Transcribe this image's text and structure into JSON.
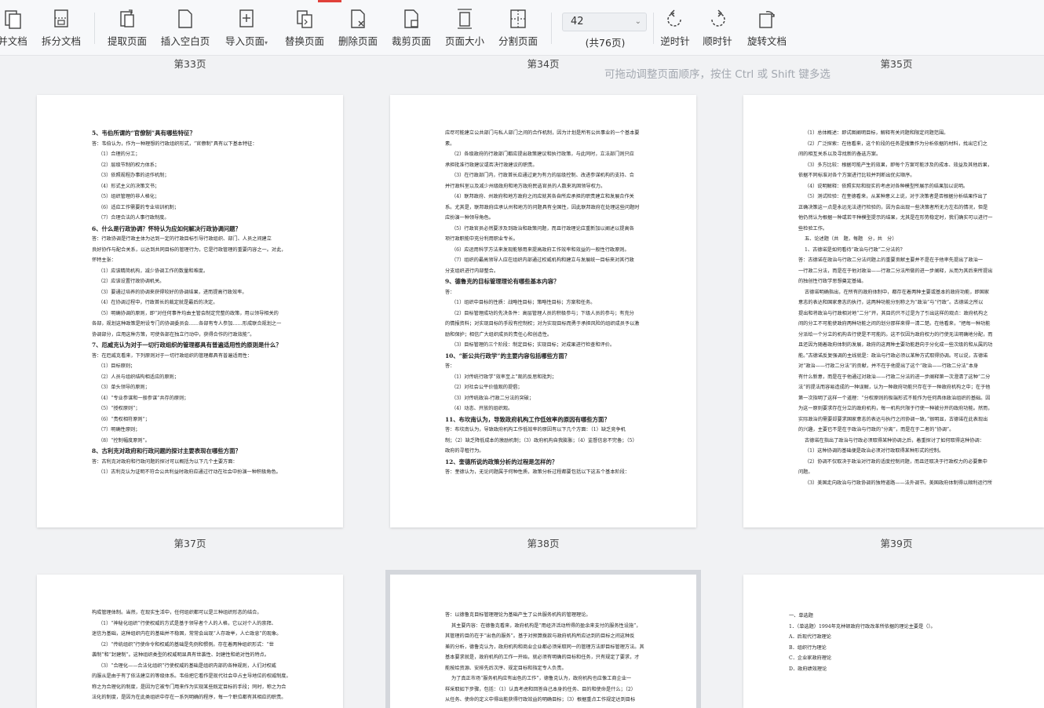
{
  "toolbar": {
    "tools": [
      {
        "label": "并文档",
        "icon": "merge-doc-icon"
      },
      {
        "label": "拆分文档",
        "icon": "split-doc-icon"
      },
      {
        "label": "提取页面",
        "icon": "extract-page-icon"
      },
      {
        "label": "插入空白页",
        "icon": "insert-blank-icon"
      },
      {
        "label": "导入页面",
        "icon": "import-page-icon"
      },
      {
        "label": "替换页面",
        "icon": "replace-page-icon"
      },
      {
        "label": "删除页面",
        "icon": "delete-page-icon"
      },
      {
        "label": "裁剪页面",
        "icon": "crop-page-icon"
      },
      {
        "label": "页面大小",
        "icon": "page-size-icon"
      },
      {
        "label": "分割页面",
        "icon": "divide-page-icon"
      },
      {
        "label": "逆时针",
        "icon": "rotate-ccw-icon"
      },
      {
        "label": "顺时针",
        "icon": "rotate-cw-icon"
      },
      {
        "label": "旋转文档",
        "icon": "rotate-doc-icon"
      }
    ],
    "page_input": "42",
    "page_count": "(共76页)",
    "dropdown_caret": "▾"
  },
  "hint": "可拖动调整页面顺序，按住 Ctrl 或 Shift 键多选",
  "top_labels": [
    "第33页",
    "第34页",
    "第35页"
  ],
  "mid_labels": [
    "第37页",
    "第38页",
    "第39页"
  ],
  "pages": [
    {
      "lines": [
        {
          "t": "5、韦伯所谓的“官僚制”具有哪些特征？",
          "c": "h"
        },
        {
          "t": "答：韦伯认为，作为一种理想的行政组织形式，“官僚制”具有以下基本特征：",
          "c": ""
        },
        {
          "t": "（1）合理的分工；",
          "c": "i"
        },
        {
          "t": "（2）层级节制的权力体系；",
          "c": "i"
        },
        {
          "t": "（3）依照规程办事的运作机制；",
          "c": "i"
        },
        {
          "t": "（4）形式主义的决策文书；",
          "c": "i"
        },
        {
          "t": "（5）组织管理的非人格化；",
          "c": "i"
        },
        {
          "t": "（6）适应工作需要的专业培训机制；",
          "c": "i"
        },
        {
          "t": "（7）合理合法的人事行政制度。",
          "c": "i"
        },
        {
          "t": "6、什么是行政协调？怀特认为应如何解决行政协调问题？",
          "c": "h"
        },
        {
          "t": "答：行政协调是行政主体为达到一定的行政目标引导行政组织、部门、人员之间建立",
          "c": ""
        },
        {
          "t": "良好协作与配合关系，以达到共同目标的管理行为，它是行政管理的重要内容之一。对此，",
          "c": ""
        },
        {
          "t": "怀特主张：",
          "c": ""
        },
        {
          "t": "（1）应该精简机构，减少协调工作的数量和难度。",
          "c": "i"
        },
        {
          "t": "（2）应该设置行政协调机关。",
          "c": "i"
        },
        {
          "t": "（3）要通过培养的协调来获得较好的协调结果，进而提高行政效率。",
          "c": "i"
        },
        {
          "t": "（4）在协调过程中，行政首长的裁定就是最后的决定。",
          "c": "i"
        },
        {
          "t": "（5）明确协调的原则，即“对任何事件均由主管会制定完整的政策，用以领导相关的",
          "c": "i"
        },
        {
          "t": "各部，规划这种政策是附设专门的协调委员会……各部有专人参加……形成联合规划之一",
          "c": ""
        },
        {
          "t": "协调部分，应用这种方策，可使各部在独立行动中，获得合作的行政效能”。",
          "c": ""
        },
        {
          "t": "7、厄威克认为对于一切行政组织的管理都具有普遍适用性的原则是什么？",
          "c": "h"
        },
        {
          "t": "答：在厄威克看来，下列原则对于一切行政组织的管理都具有普遍适用性：",
          "c": ""
        },
        {
          "t": "（1）目标原则；",
          "c": "i"
        },
        {
          "t": "（2）人员与组织结构相适应的原则；",
          "c": "i"
        },
        {
          "t": "（3）单头领导的原则；",
          "c": "i"
        },
        {
          "t": "（4）“专业参谋和一般参谋”共存的原则；",
          "c": "i"
        },
        {
          "t": "（5）“授权原则”；",
          "c": "i"
        },
        {
          "t": "（6）“责权相符原则”；",
          "c": "i"
        },
        {
          "t": "（7）明确性原则；",
          "c": "i"
        },
        {
          "t": "（8）“控制幅度原则”。",
          "c": "i"
        },
        {
          "t": "8、古利克对政府和行政问题的探讨主要表现在哪些方面？",
          "c": "h"
        },
        {
          "t": "答：古利克对政府和行政问题的探讨可以概括为以下几个主要方面：",
          "c": ""
        },
        {
          "t": "（1）古利克认为证明不符合公共利益时政府应通过行动在社会中扮演一种积极角色。",
          "c": "i"
        }
      ]
    },
    {
      "lines": [
        {
          "t": "应尽可能建立公共部门与私人部门之间的合作机制，因为计划是所有公共事业的一个基本要",
          "c": ""
        },
        {
          "t": "素。",
          "c": ""
        },
        {
          "t": "（2）各级政府的行政部门都应提出政策建议和执行政策，与此同时，立法部门则只应",
          "c": "i"
        },
        {
          "t": "承担批准行政建议或否决行政建议的职责。",
          "c": ""
        },
        {
          "t": "（3）在行政部门内，行政首长应通过更为有力的层级控制、改进参谋机构的支持、合",
          "c": "i"
        },
        {
          "t": "并行政科室以及减少州级政府和地方政府民选官员的人数来巩固领导权力。",
          "c": ""
        },
        {
          "t": "（4）联邦政府、州政府和地方政府之间应就其各自所应承担的职责建立和发展合作关",
          "c": "i"
        },
        {
          "t": "系。尤其是，联邦政府应承认州和地方的问题具有全国性，因此联邦政府在处理这些问题时",
          "c": ""
        },
        {
          "t": "应扮演一种领导角色。",
          "c": ""
        },
        {
          "t": "（5）行政官员必然要涉及到政治和政策问题，而且行政理论应重新加以阐述以提高各",
          "c": "i"
        },
        {
          "t": "项行政职能中充分利用职业专长。",
          "c": ""
        },
        {
          "t": "（6）应运用科学方法来发现能够用来提高政府工作效率和效益的一般性行政原则。",
          "c": "i"
        },
        {
          "t": "（7）组织的最高领导人应在组织内部通过权威机构和建立与发展统一目标来对其行政",
          "c": "i"
        },
        {
          "t": "分支组织进行内部整合。",
          "c": ""
        },
        {
          "t": "9、德鲁克的目标管理理论有哪些基本内容？",
          "c": "h"
        },
        {
          "t": "答：",
          "c": ""
        },
        {
          "t": "（1）组织中目标的性质：战略性目标；策略性目标；方案和任务。",
          "c": "i"
        },
        {
          "t": "（2）目标管理成功的先决条件：高层管理人员的积极参与；下级人员的参与；有充分",
          "c": "i"
        },
        {
          "t": "的情报资料；对实现目标的手段有控制权；对为实现目标而勇于承担风险的组织成员予以激",
          "c": ""
        },
        {
          "t": "励和保护；相信广大组织成员的责任心和创造性。",
          "c": ""
        },
        {
          "t": "（3）目标管理的三个阶段：制定目标；实现目标；对成果进行检查和评价。",
          "c": "i"
        },
        {
          "t": "10、“新公共行政学”的主要内容包括哪些方面？",
          "c": "h"
        },
        {
          "t": "答：",
          "c": ""
        },
        {
          "t": "（1）对传统行政学“效率至上”观的反思和批判；",
          "c": "i"
        },
        {
          "t": "（2）对社会公平价值观的提倡；",
          "c": "i"
        },
        {
          "t": "（3）对传统政治-行政二分法的突破；",
          "c": "i"
        },
        {
          "t": "（4）动态、开放的组织观。",
          "c": "i"
        },
        {
          "t": "11、布坎南认为，导致政府机构工作低效率的原因有哪些方面？",
          "c": "h"
        },
        {
          "t": "答：布坎南认为，导致政府机构工作低效率的原因有以下几个方面：（1）缺乏竞争机",
          "c": ""
        },
        {
          "t": "制；（2）缺乏降低成本的激励机制；（3）政府机构自我膨胀；（4）监督信息不完备；（5）",
          "c": ""
        },
        {
          "t": "政府的寻租行为。",
          "c": ""
        },
        {
          "t": "12、奎德所说的政策分析的过程是怎样的？",
          "c": "h"
        },
        {
          "t": "答：奎德认为，无论问题属于何种性质，政策分析过程都要包括以下这五个基本阶段：",
          "c": ""
        }
      ]
    },
    {
      "lines": [
        {
          "t": "（1）总体概述：即试图阐明目标，解释有关问题和限定问题范围。",
          "c": "i"
        },
        {
          "t": "（2）广泛探索：在他看来，这个阶段的任务是搜集作为分析依据的材料，找出它们之",
          "c": "i"
        },
        {
          "t": "间的相互关系以及寻找新的备选方案。",
          "c": ""
        },
        {
          "t": "（3）多方比较：根据可能产生的效果，即每个方案可能涉及的成本、效益及其他后果，",
          "c": "i"
        },
        {
          "t": "依据不同标准对各个方案进行比较并判断出优劣顺序。",
          "c": ""
        },
        {
          "t": "（4）说明解释：依照实际和现实的考虑对各种模型所展示的结果加以说明。",
          "c": "i"
        },
        {
          "t": "（5）测试检验：在奎德看来，从某种意义上说，对于决策者是否根据分析结果作出了",
          "c": "i"
        },
        {
          "t": "正确决策这一点是永远无法进行检验的，因为会出现一些决策者所无力左右的情况，但是",
          "c": ""
        },
        {
          "t": "他仍然认为根据一种或若干种模型提示的结果，尤其是在形势稳定时，我们确实可以进行一",
          "c": ""
        },
        {
          "t": "些检验工作。",
          "c": ""
        },
        {
          "t": "五、论述题（共　题，每题　分，共　分）",
          "c": "i"
        },
        {
          "t": "1、古德诺是如何看待“政治与行政”二分法的？",
          "c": "i"
        },
        {
          "t": "答：古德诺在政治与行政二分法问题上的重要贡献主要并不是在于他率先提出了政治一",
          "c": ""
        },
        {
          "t": "一行政二分法，而是在于他对政治——行政二分法所做的进一步阐释，从而为其后来所提出",
          "c": ""
        },
        {
          "t": "的独创性行政学思想奠定基础。",
          "c": ""
        },
        {
          "t": "古德诺明确指出，在所有的政府体制中，都存在着两种主要或基本的政府功能，即国家",
          "c": "i"
        },
        {
          "t": "意志的表达和国家意志的执行，这两种功能分别称之为“政治”与“行政”。古德诺之所以",
          "c": ""
        },
        {
          "t": "提出和将政治与行政相对地“二分”开，其目的只不过是为了引出这样的观点：政府机构之",
          "c": ""
        },
        {
          "t": "间的分工不可能使政府两种功能之间的划分那样来得一清二楚。在他看来，“把每一种功能",
          "c": ""
        },
        {
          "t": "分派给一个分立的机构去行使是不可能的。这不仅因为政府权力的行使无法明确地分配，而",
          "c": ""
        },
        {
          "t": "且还因为随着政府体制的发展，政府的这两种主要功能趋向于分化成一些次级的和从属的功",
          "c": ""
        },
        {
          "t": "能。”古德诺反复强调的主线就是：政治与行政必须以某种方式取得协调。可以说，古德诺",
          "c": ""
        },
        {
          "t": "对“政治——行政二分法”的贡献，并不在于他提出了这个“政治——行政二分法”本身",
          "c": ""
        },
        {
          "t": "有什么新意，而是在于他通过对政治——行政二分法的进一步阐释第一次澄清了这种“二分",
          "c": ""
        },
        {
          "t": "法”的提法而容易造成的一种误解，认为一种政府功能只存在于一种政府机构之中；在于他",
          "c": ""
        },
        {
          "t": "第一次指明了这样一个道理：“分权原则的极端形式不能作为任何具体政治组织的基础。因",
          "c": ""
        },
        {
          "t": "为这一原则要求存在分立的政府机构，每一机构只限于行使一种被分开的政府功能。然而，",
          "c": ""
        },
        {
          "t": "实际政治的需要却要求国家意志的表达与执行之间协调一致。”很明显，古德诺在此表现出",
          "c": ""
        },
        {
          "t": "的兴趣，主要已不是在于政治与行政的“分离”，而是在于二者的“协调”。",
          "c": ""
        },
        {
          "t": "古德诺在指出了政治与行政必须取得某种协调之后，着重探讨了如何取得这种协调：",
          "c": "i"
        },
        {
          "t": "（1）这种协调的基础便是政治必须对行政取得某种形式的控制。",
          "c": "i"
        },
        {
          "t": "（2）协调不仅取决于政治对行政的适度控制问题，而且还取决于行政权力的必要集中",
          "c": "i"
        },
        {
          "t": "问题。",
          "c": ""
        },
        {
          "t": "（3）美国走向政治与行政协调的独特道路——法外调节。美国政府体制得以顺利运行所",
          "c": "i"
        }
      ]
    },
    {
      "lines": [
        {
          "t": "构成管理体制。当然，在现实生活中，任何组织都可以是三种组织形态的结合。",
          "c": ""
        },
        {
          "t": "（1）“神秘化组织”行使权威的方式是基于领导者个人的人格，它以对个人的崇拜、",
          "c": "i"
        },
        {
          "t": "迷信为基础，这种组织内在的基础并不稳固，常常会出现“人存政举，人亡政息”的现象。",
          "c": ""
        },
        {
          "t": "（2）“传统组织”行使命令和权威的基础是先例和惯例。存在着两种组织形式：“世",
          "c": "i"
        },
        {
          "t": "袭制”和“封建制”。这种组织类型的权威明显具有世袭性、封建性和绝对性的特点。",
          "c": ""
        },
        {
          "t": "（3）“合理化——合法化组织”行使权威的基础是组织内部的各种规则，人们对权威",
          "c": "i"
        },
        {
          "t": "的服从是由于有了依法建立的等级体系。韦伯把它看作是现代社会中占主导地位的权威制度。",
          "c": ""
        },
        {
          "t": "称之为合理化的制度，是因为它被专门用来作为实现某些既定目标的手段；同时，称之为合",
          "c": ""
        },
        {
          "t": "法化的制度，是因为在此类组织中存在一系列明确的程序，每一个职位都有其相应的职责。",
          "c": ""
        }
      ]
    },
    {
      "lines": [
        {
          "t": "答：以德鲁克目标管理理论为基础产生了公共服务机构的管理理论。",
          "c": ""
        },
        {
          "t": "其主要内容：在德鲁克看来，政府机构是“用经济活动所得的盈余来支付的服务性设施”，",
          "c": "i"
        },
        {
          "t": "其管理的目的在于“出色的服务”。基于对预算拨款与政府机构所应达到的目标之间这种反",
          "c": ""
        },
        {
          "t": "差的分析，德鲁克认为，政府机构和商业企业都必须采取同一的管理方法即目标管理方法。其",
          "c": ""
        },
        {
          "t": "基本要求就是，政府机构的工作一开始，就必须有明确的目标和任务，只有规定了要求，才",
          "c": ""
        },
        {
          "t": "能按给资源、安排先后次序、规定目标和指定专人负责。",
          "c": ""
        },
        {
          "t": "为了真正市场“服务机构应有出色的工作”，德鲁克认为，政府机构也应像工商企业一",
          "c": "i"
        },
        {
          "t": "样采取如下步骤，包括：（1）认真考虑和回答自己本身的任务、目的和使命是什么；（2）",
          "c": ""
        },
        {
          "t": "从任务、使命的定义中得出能获得行政效益的明确目标；（3）根据重点工作规定达到目标",
          "c": ""
        }
      ]
    },
    {
      "lines": [
        {
          "t": "一、单选题",
          "c": ""
        },
        {
          "t": "1．（单选题）1994年克林顿政府行政改革所依据的理论主要是（）。",
          "c": ""
        },
        {
          "t": "A．后现代行政理论",
          "c": ""
        },
        {
          "t": "B．组织行为理论",
          "c": ""
        },
        {
          "t": "C．企业家政府理论",
          "c": ""
        },
        {
          "t": "D．政府绩效理论",
          "c": ""
        }
      ]
    }
  ]
}
